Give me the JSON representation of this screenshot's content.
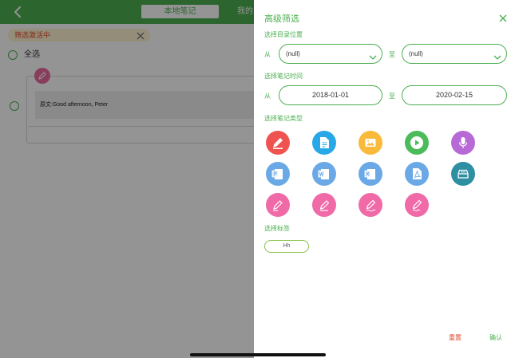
{
  "background": {
    "tabs": {
      "local_notes": "本地笔记",
      "mine": "我的"
    },
    "filter_banner": {
      "text": "筛选激活中"
    },
    "select_all": {
      "label": "全选"
    },
    "note": {
      "text": "原文:Good afternoon, Peter"
    }
  },
  "panel": {
    "title": "高级筛选",
    "directory": {
      "label": "选择目录位置",
      "from_label": "从",
      "to_label": "至",
      "from_value": "(null)",
      "to_value": "(null)"
    },
    "time": {
      "label": "选择笔记时间",
      "from_label": "从",
      "to_label": "至",
      "start_date": "2018-01-01",
      "end_date": "2020-02-15"
    },
    "types": {
      "label": "选择笔记类型",
      "items": [
        {
          "icon": "edit-note-icon",
          "color": "#ef5350"
        },
        {
          "icon": "document-icon",
          "color": "#29a8e8"
        },
        {
          "icon": "image-icon",
          "color": "#f9b93b"
        },
        {
          "icon": "video-play-icon",
          "color": "#4cbb5a"
        },
        {
          "icon": "microphone-icon",
          "color": "#b76ad6"
        },
        {
          "icon": "powerpoint-icon",
          "color": "#6aa9e6"
        },
        {
          "icon": "word-icon",
          "color": "#6aa9e6"
        },
        {
          "icon": "excel-icon",
          "color": "#6aa9e6"
        },
        {
          "icon": "pdf-icon",
          "color": "#6aa9e6"
        },
        {
          "icon": "scanner-icon",
          "color": "#2e8fa3"
        },
        {
          "icon": "highlighter-icon",
          "color": "#f06aa8"
        },
        {
          "icon": "pen-icon",
          "color": "#f06aa8"
        },
        {
          "icon": "handwriting-icon",
          "color": "#f06aa8"
        },
        {
          "icon": "signature-pen-icon",
          "color": "#f06aa8"
        }
      ]
    },
    "tags": {
      "label": "选择标签",
      "items": [
        "Hh"
      ]
    },
    "actions": {
      "reset": "重置",
      "confirm": "确认"
    }
  },
  "colors": {
    "accent": "#4caf50",
    "danger": "#e24b2f",
    "banner_bg": "#fdf3d0"
  }
}
